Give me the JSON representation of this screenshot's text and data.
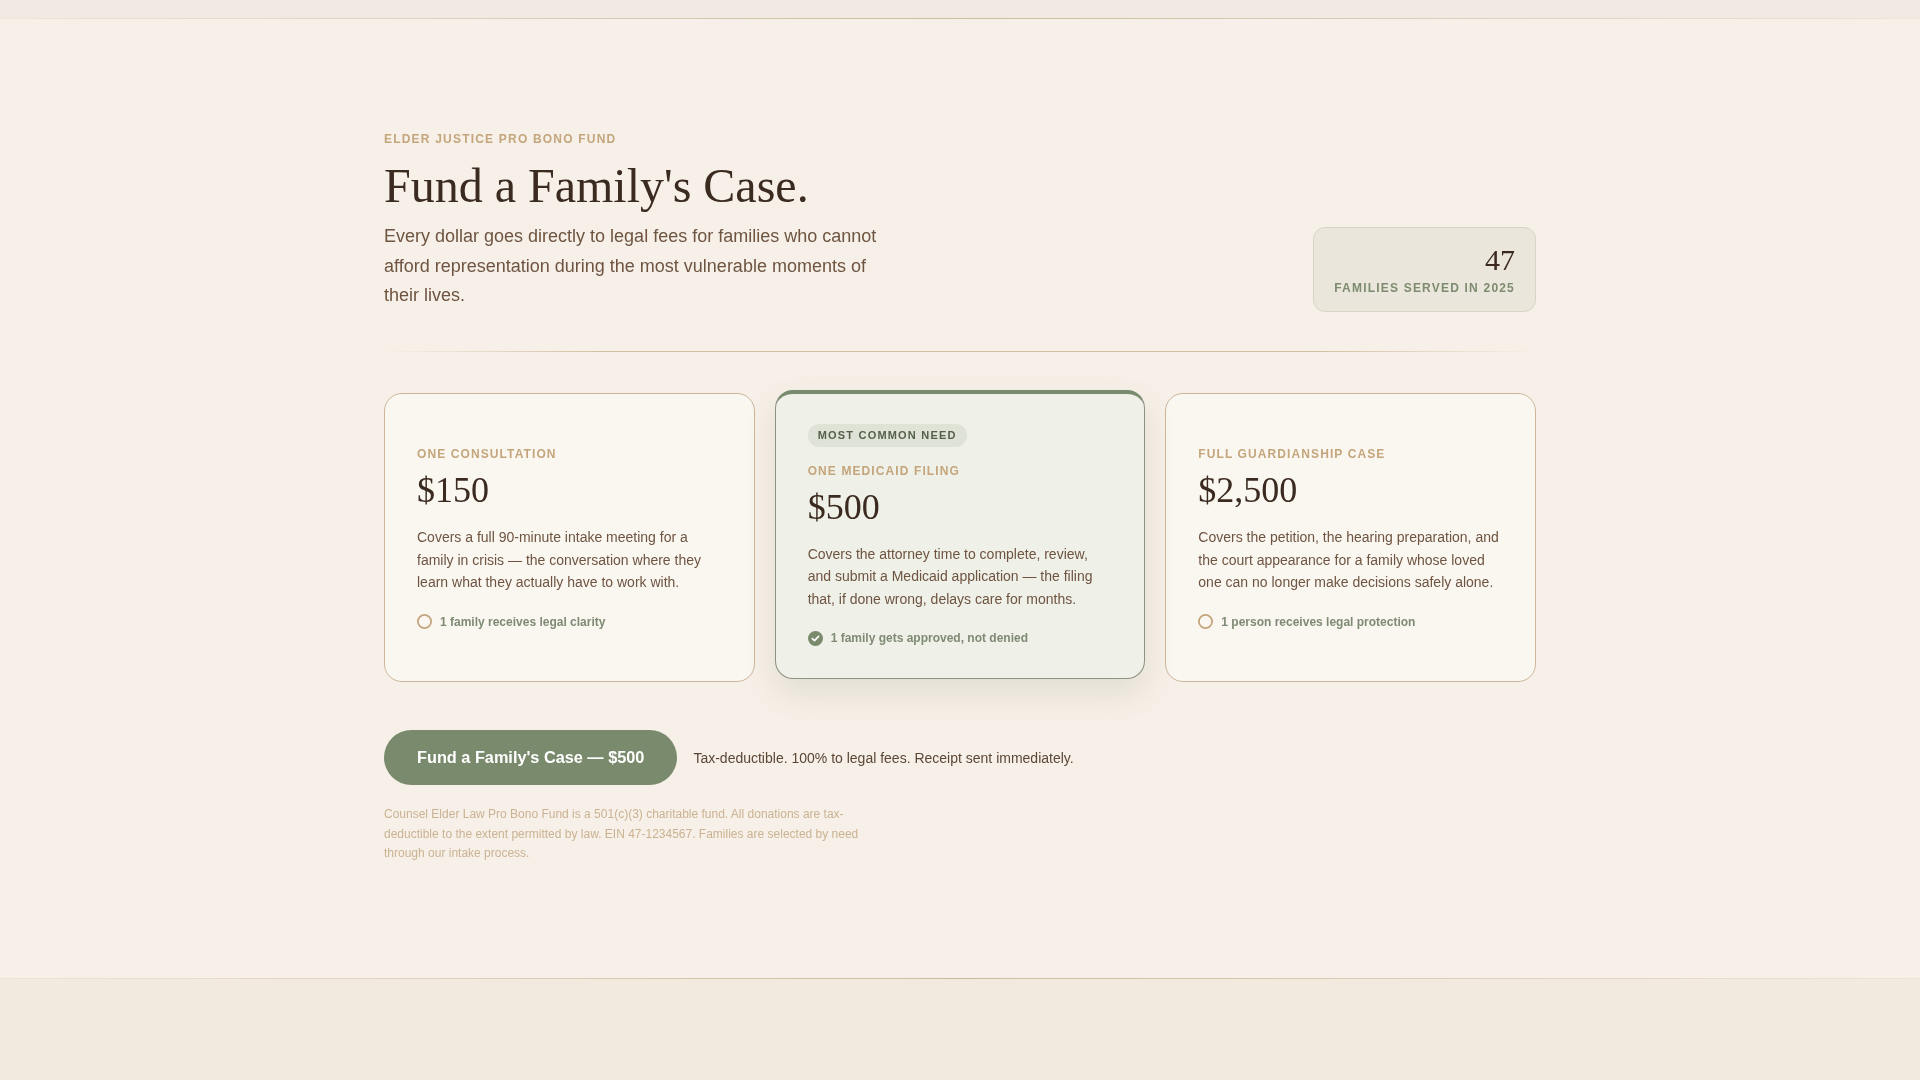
{
  "header": {
    "eyebrow": "ELDER JUSTICE PRO BONO FUND",
    "title": "Fund a Family's Case.",
    "intro": "Every dollar goes directly to legal fees for families who cannot afford representation during the most vulnerable moments of their lives."
  },
  "stat": {
    "value": "47",
    "label": "FAMILIES SERVED IN 2025"
  },
  "tiers": [
    {
      "label": "ONE CONSULTATION",
      "price": "$150",
      "description": "Covers a full 90-minute intake meeting for a family in crisis — the conversation where they learn what they actually have to work with.",
      "outcome": "1 family receives legal clarity",
      "selected": false
    },
    {
      "badge": "MOST COMMON NEED",
      "label": "ONE MEDICAID FILING",
      "price": "$500",
      "description": "Covers the attorney time to complete, review, and submit a Medicaid application — the filing that, if done wrong, delays care for months.",
      "outcome": "1 family gets approved, not denied",
      "selected": true
    },
    {
      "label": "FULL GUARDIANSHIP CASE",
      "price": "$2,500",
      "description": "Covers the petition, the hearing preparation, and the court appearance for a family whose loved one can no longer make decisions safely alone.",
      "outcome": "1 person receives legal protection",
      "selected": false
    }
  ],
  "cta": {
    "button": "Fund a Family's Case — $500",
    "note": "Tax-deductible. 100% to legal fees. Receipt sent immediately."
  },
  "disclaimer": "Counsel Elder Law Pro Bono Fund is a 501(c)(3) charitable fund. All donations are tax-deductible to the extent permitted by law. EIN 47-1234567. Families are selected by need through our intake process."
}
